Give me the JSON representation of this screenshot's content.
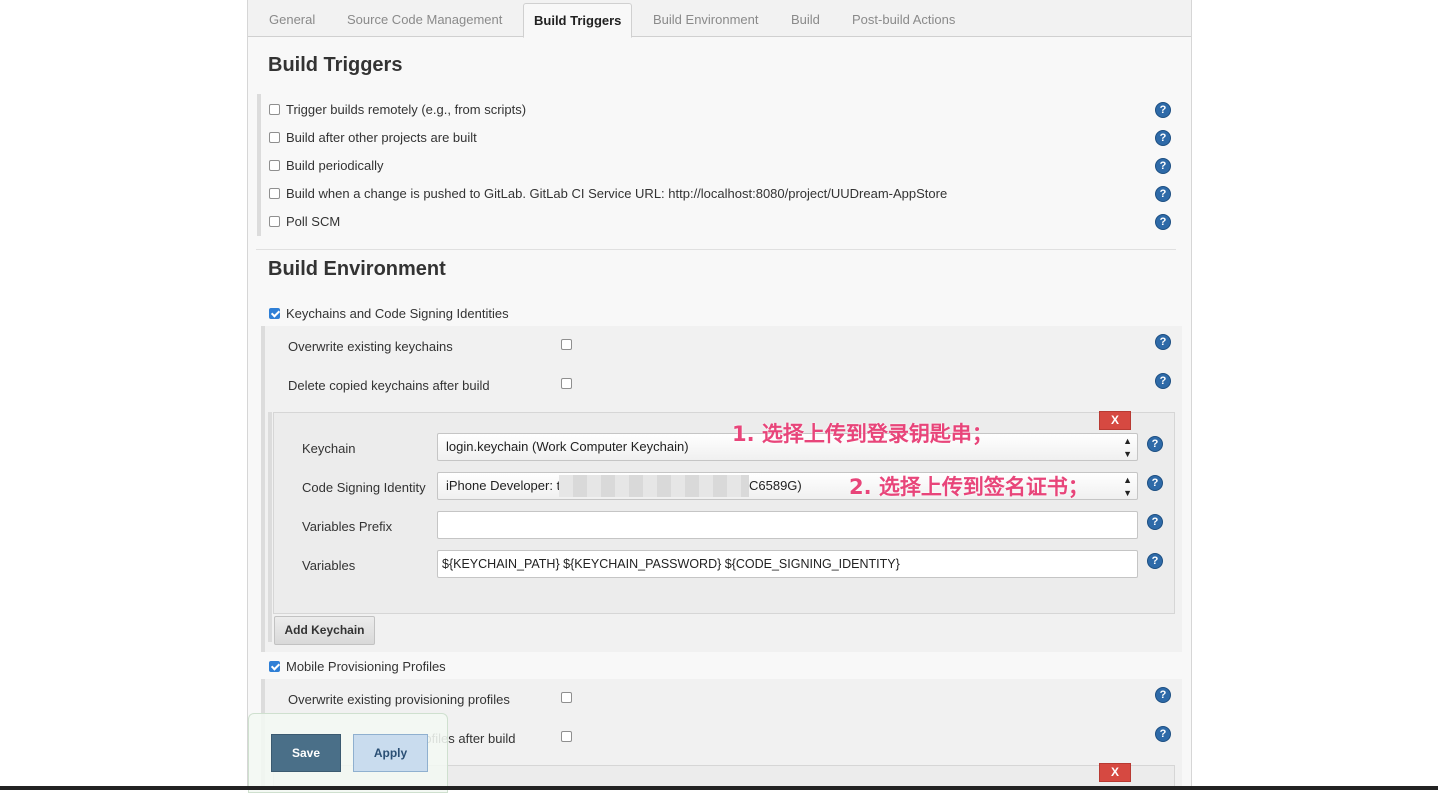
{
  "tabs": [
    {
      "label": "General"
    },
    {
      "label": "Source Code Management"
    },
    {
      "label": "Build Triggers"
    },
    {
      "label": "Build Environment"
    },
    {
      "label": "Build"
    },
    {
      "label": "Post-build Actions"
    }
  ],
  "build_triggers": {
    "title": "Build Triggers",
    "options": [
      {
        "label": "Trigger builds remotely (e.g., from scripts)",
        "checked": false
      },
      {
        "label": "Build after other projects are built",
        "checked": false
      },
      {
        "label": "Build periodically",
        "checked": false
      },
      {
        "label": "Build when a change is pushed to GitLab. GitLab CI Service URL: http://localhost:8080/project/UUDream-AppStore",
        "checked": false
      },
      {
        "label": "Poll SCM",
        "checked": false
      }
    ]
  },
  "build_environment": {
    "title": "Build Environment",
    "keychains": {
      "label": "Keychains and Code Signing Identities",
      "checked": true,
      "overwrite_label": "Overwrite existing keychains",
      "delete_label": "Delete copied keychains after build",
      "delete_button": "X",
      "keychain_label": "Keychain",
      "keychain_value": "login.keychain (Work Computer Keychain)",
      "identity_label": "Code Signing Identity",
      "identity_value_start": "iPhone Developer: t",
      "identity_value_end": "C6589G)",
      "prefix_label": "Variables Prefix",
      "prefix_value": "",
      "variables_label": "Variables",
      "variables_value": "${KEYCHAIN_PATH} ${KEYCHAIN_PASSWORD} ${CODE_SIGNING_IDENTITY}",
      "add_button": "Add Keychain"
    },
    "provisioning": {
      "label": "Mobile Provisioning Profiles",
      "checked": true,
      "overwrite_label": "Overwrite existing provisioning profiles",
      "delete_label_visible": "g profiles after build",
      "delete_button": "X"
    }
  },
  "annotations": {
    "first": "1. 选择上传到登录钥匙串；",
    "second": "2. 选择上传到签名证书；"
  },
  "footer": {
    "save_label": "Save",
    "apply_label": "Apply"
  },
  "colors": {
    "annotation": "#e8457a",
    "help_icon": "#2e6aa8",
    "delete_button": "#d64941",
    "save_button": "#4a6f88",
    "apply_button": "#c9dcee"
  }
}
